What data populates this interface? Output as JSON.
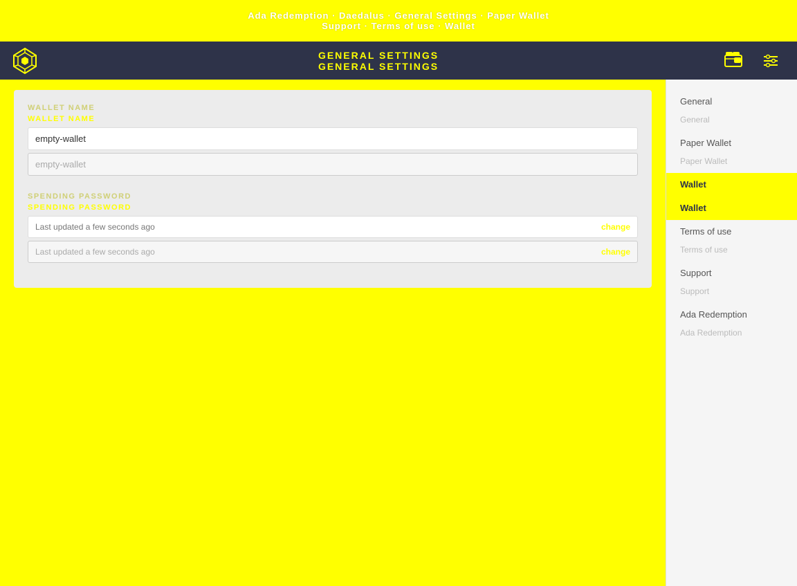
{
  "top_banner": {
    "line1": "Ada Redemption · Daedalus · General Settings · Paper Wallet",
    "line2": "Support · Terms of use · Wallet"
  },
  "navbar": {
    "title": "GENERAL SETTINGS",
    "subtitle": "GENERAL SETTINGS",
    "logo_alt": "Daedalus logo"
  },
  "wallet_name_section": {
    "label": "WALLET NAME",
    "label_ghost": "WALLET NAME",
    "value": "empty-wallet",
    "value_ghost": "empty-wallet"
  },
  "spending_password_section": {
    "label": "SPENDING PASSWORD",
    "label_ghost": "SPENDING PASSWORD",
    "row1_text": "Last updated a few seconds ago",
    "row1_change": "change",
    "row2_text": "Last updated a few seconds ago",
    "row2_change": "change"
  },
  "sidebar": {
    "items": [
      {
        "id": "general",
        "label": "General",
        "active": false
      },
      {
        "id": "general2",
        "label": "General",
        "active": false,
        "ghost": true
      },
      {
        "id": "paper-wallet",
        "label": "Paper Wallet",
        "active": false
      },
      {
        "id": "paper-wallet2",
        "label": "Paper Wallet",
        "active": false,
        "ghost": true
      },
      {
        "id": "wallet",
        "label": "Wallet",
        "active": true
      },
      {
        "id": "wallet2",
        "label": "Wallet",
        "active": true,
        "ghost": true
      },
      {
        "id": "terms-of-use",
        "label": "Terms of use",
        "active": false
      },
      {
        "id": "terms-of-use2",
        "label": "Terms of use",
        "active": false,
        "ghost": true
      },
      {
        "id": "support",
        "label": "Support",
        "active": false
      },
      {
        "id": "support2",
        "label": "Support",
        "active": false,
        "ghost": true
      },
      {
        "id": "ada-redemption",
        "label": "Ada Redemption",
        "active": false
      },
      {
        "id": "ada-redemption2",
        "label": "Ada Redemption",
        "active": false,
        "ghost": true
      }
    ]
  },
  "save_button": {
    "label": ""
  }
}
